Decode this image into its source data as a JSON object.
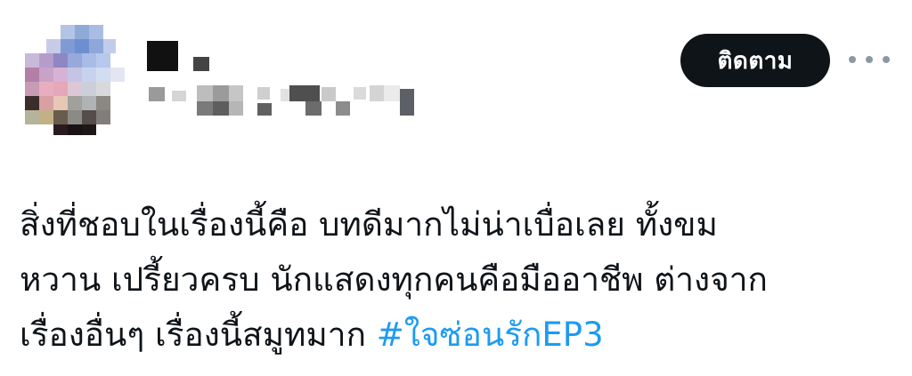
{
  "header": {
    "follow_label": "ติดตาม",
    "more_label": "More"
  },
  "tweet": {
    "line1": "สิ่งที่ชอบในเรื่องนี้คือ บทดีมากไม่น่าเบื่อเลย ทั้งขม",
    "line2": "หวาน เปรี้ยวครบ นักแสดงทุกคนคือมืออาชีพ ต่างจาก",
    "line3": "เรื่องอื่นๆ เรื่องนี้สมูทมาก ",
    "hashtag": "#ใจซ่อนรักEP3"
  },
  "colors": {
    "follow_bg": "#0f1419",
    "hashtag": "#1d9bf0",
    "text": "#0f1419"
  }
}
